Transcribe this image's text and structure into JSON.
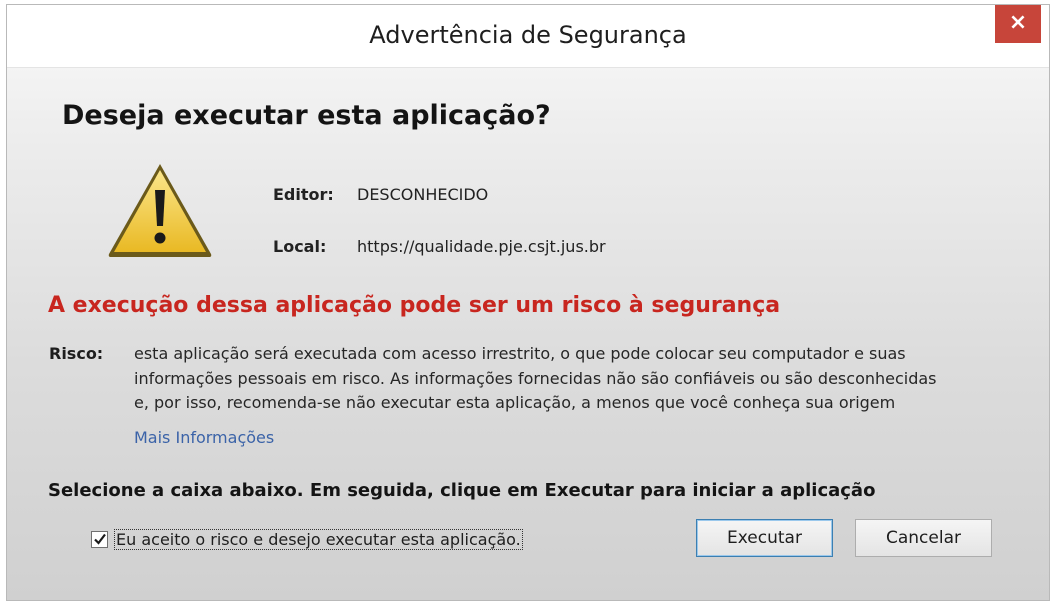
{
  "window": {
    "title": "Advertência de Segurança",
    "close_glyph": "×"
  },
  "dialog": {
    "heading": "Deseja executar esta aplicação?",
    "icon": "warning-triangle-icon",
    "publisher_label": "Editor:",
    "publisher_value": "DESCONHECIDO",
    "location_label": "Local:",
    "location_value": "https://qualidade.pje.csjt.jus.br",
    "risk_heading": "A execução dessa aplicação pode ser um risco à segurança",
    "risk_label": "Risco:",
    "risk_text": "esta aplicação será executada com acesso irrestrito, o que pode colocar seu computador e suas\ninformações pessoais em risco. As informações fornecidas não são confiáveis ou são desconhecidas\ne, por isso, recomenda-se não executar esta aplicação, a menos que você conheça sua origem",
    "more_info_link": "Mais Informações",
    "instruction": "Selecione a caixa abaixo. Em seguida, clique em Executar para iniciar a aplicação",
    "accept_checkbox_label": "Eu aceito o risco e desejo executar esta aplicação.",
    "accept_checked": true
  },
  "buttons": {
    "run_label": "Executar",
    "cancel_label": "Cancelar"
  },
  "colors": {
    "risk_heading": "#c8261f",
    "close_button": "#c7453a",
    "link": "#3b63a8",
    "warning_fill": "#f4d24a"
  }
}
